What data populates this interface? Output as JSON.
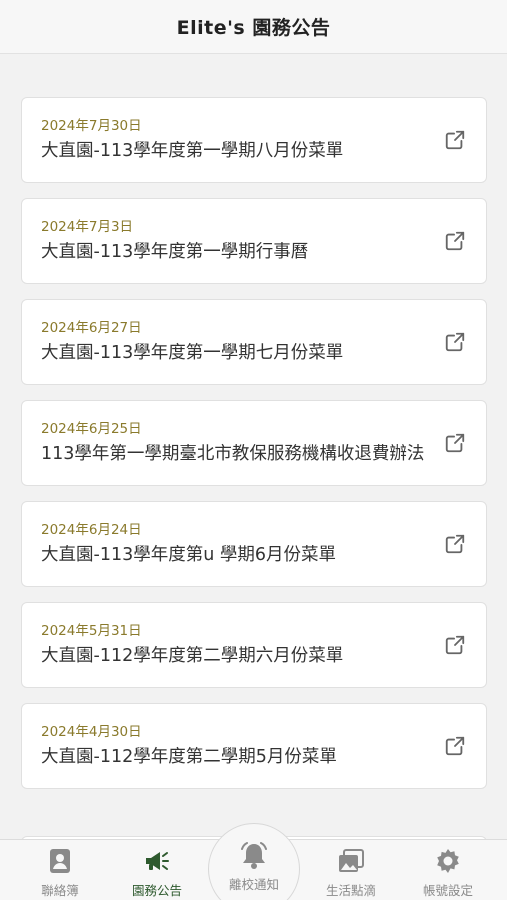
{
  "header": {
    "title": "Elite's 園務公告"
  },
  "announcements": [
    {
      "date": "2024年7月30日",
      "title": "大直園-113學年度第一學期八月份菜單"
    },
    {
      "date": "2024年7月3日",
      "title": "大直園-113學年度第一學期行事曆"
    },
    {
      "date": "2024年6月27日",
      "title": "大直園-113學年度第一學期七月份菜單"
    },
    {
      "date": "2024年6月25日",
      "title": "113學年第一學期臺北市教保服務機構收退費辦法"
    },
    {
      "date": "2024年6月24日",
      "title": "大直園-113學年度第u 學期6月份菜單"
    },
    {
      "date": "2024年5月31日",
      "title": "大直園-112學年度第二學期六月份菜單"
    },
    {
      "date": "2024年4月30日",
      "title": "大直園-112學年度第二學期5月份菜單"
    }
  ],
  "nav": {
    "items": [
      {
        "label": "聯絡簿",
        "icon": "contact-book-icon"
      },
      {
        "label": "園務公告",
        "icon": "megaphone-icon",
        "active": true
      },
      {
        "label": "離校通知",
        "icon": "bell-icon"
      },
      {
        "label": "生活點滴",
        "icon": "gallery-icon"
      },
      {
        "label": "帳號設定",
        "icon": "gear-icon"
      }
    ]
  },
  "colors": {
    "accent": "#2e5a2e",
    "date": "#8a7a2c",
    "inactive": "#8a8a8a"
  }
}
